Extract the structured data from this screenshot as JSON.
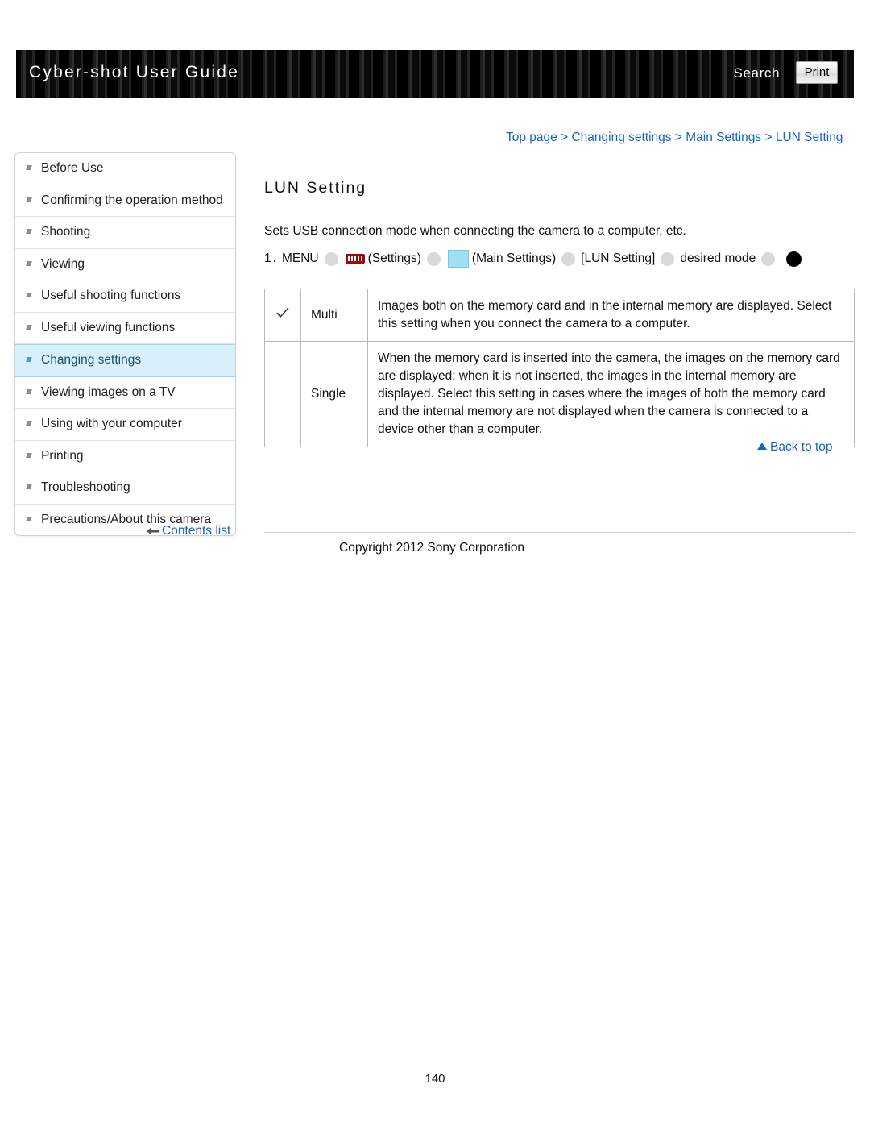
{
  "header": {
    "title": "Cyber-shot User Guide",
    "search_label": "Search",
    "print_label": "Print"
  },
  "breadcrumb": {
    "items": [
      "Top page",
      "Changing settings",
      "Main Settings",
      "LUN Setting"
    ],
    "separator": ">"
  },
  "sidebar": {
    "items": [
      {
        "label": "Before Use"
      },
      {
        "label": "Confirming the operation method"
      },
      {
        "label": "Shooting"
      },
      {
        "label": "Viewing"
      },
      {
        "label": "Useful shooting functions"
      },
      {
        "label": "Useful viewing functions"
      },
      {
        "label": "Changing settings"
      },
      {
        "label": "Viewing images on a TV"
      },
      {
        "label": "Using with your computer"
      },
      {
        "label": "Printing"
      },
      {
        "label": "Troubleshooting"
      },
      {
        "label": "Precautions/About this camera"
      }
    ],
    "selected_index": 6,
    "contents_list_label": "Contents list"
  },
  "main": {
    "title": "LUN Setting",
    "intro": "Sets USB connection mode when connecting the camera to a computer, etc.",
    "step": {
      "number": "1.",
      "menu": "MENU",
      "settings_label": "(Settings)",
      "main_settings_label": "(Main Settings)",
      "lun_setting_label": "[LUN Setting]",
      "desired_mode_label": "desired mode"
    },
    "options": [
      {
        "checked": true,
        "name": "Multi",
        "description": "Images both on the memory card and in the internal memory are displayed. Select this setting when you connect the camera to a computer."
      },
      {
        "checked": false,
        "name": "Single",
        "description": "When the memory card is inserted into the camera, the images on the memory card are displayed; when it is not inserted, the images in the internal memory are displayed. Select this setting in cases where the images of both the memory card and the internal memory are not displayed when the camera is connected to a device other than a computer."
      }
    ],
    "back_to_top": "Back to top",
    "copyright": "Copyright 2012 Sony Corporation",
    "page_number": "140"
  },
  "colors": {
    "link": "#1565c0",
    "selected_bg": "#d8f0fa",
    "settings_icon": "#9c0909",
    "main_settings_icon": "#9fe0f5"
  }
}
